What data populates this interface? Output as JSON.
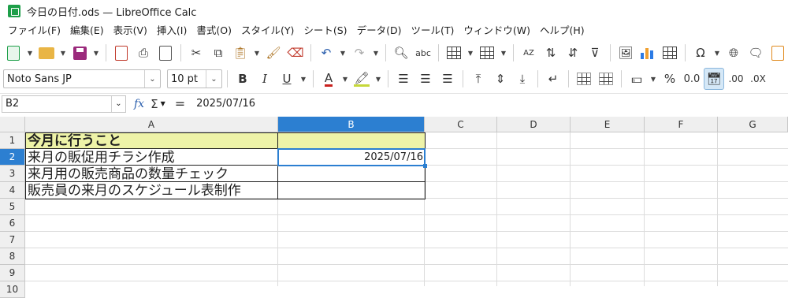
{
  "window": {
    "title": "今日の日付.ods — LibreOffice Calc"
  },
  "menu": [
    "ファイル(F)",
    "編集(E)",
    "表示(V)",
    "挿入(I)",
    "書式(O)",
    "スタイル(Y)",
    "シート(S)",
    "データ(D)",
    "ツール(T)",
    "ウィンドウ(W)",
    "ヘルプ(H)"
  ],
  "format_toolbar": {
    "font_name": "Noto Sans JP",
    "font_size": "10 pt",
    "bold": "B",
    "italic": "I",
    "underline": "U",
    "percent": "%",
    "number": "0.0",
    "add_decimal": ".00",
    "remove_decimal": ".0X"
  },
  "formula_bar": {
    "cell_ref": "B2",
    "fx": "fx",
    "sigma": "Σ",
    "equals": "=",
    "content": "2025/07/16"
  },
  "sheet": {
    "columns": [
      "A",
      "B",
      "C",
      "D",
      "E",
      "F",
      "G"
    ],
    "rows": [
      "1",
      "2",
      "3",
      "4",
      "5",
      "6",
      "7",
      "8",
      "9",
      "10"
    ],
    "cells": {
      "A1": "今月に行うこと",
      "A2": "来月の販促用チラシ作成",
      "A3": "来月用の販売商品の数量チェック",
      "A4": "販売員の来月のスケジュール表制作",
      "B2": "2025/07/16"
    },
    "selected_cell": "B2",
    "colors": {
      "header_fill": "#eef3a8",
      "selection": "#2c7fd1"
    }
  }
}
